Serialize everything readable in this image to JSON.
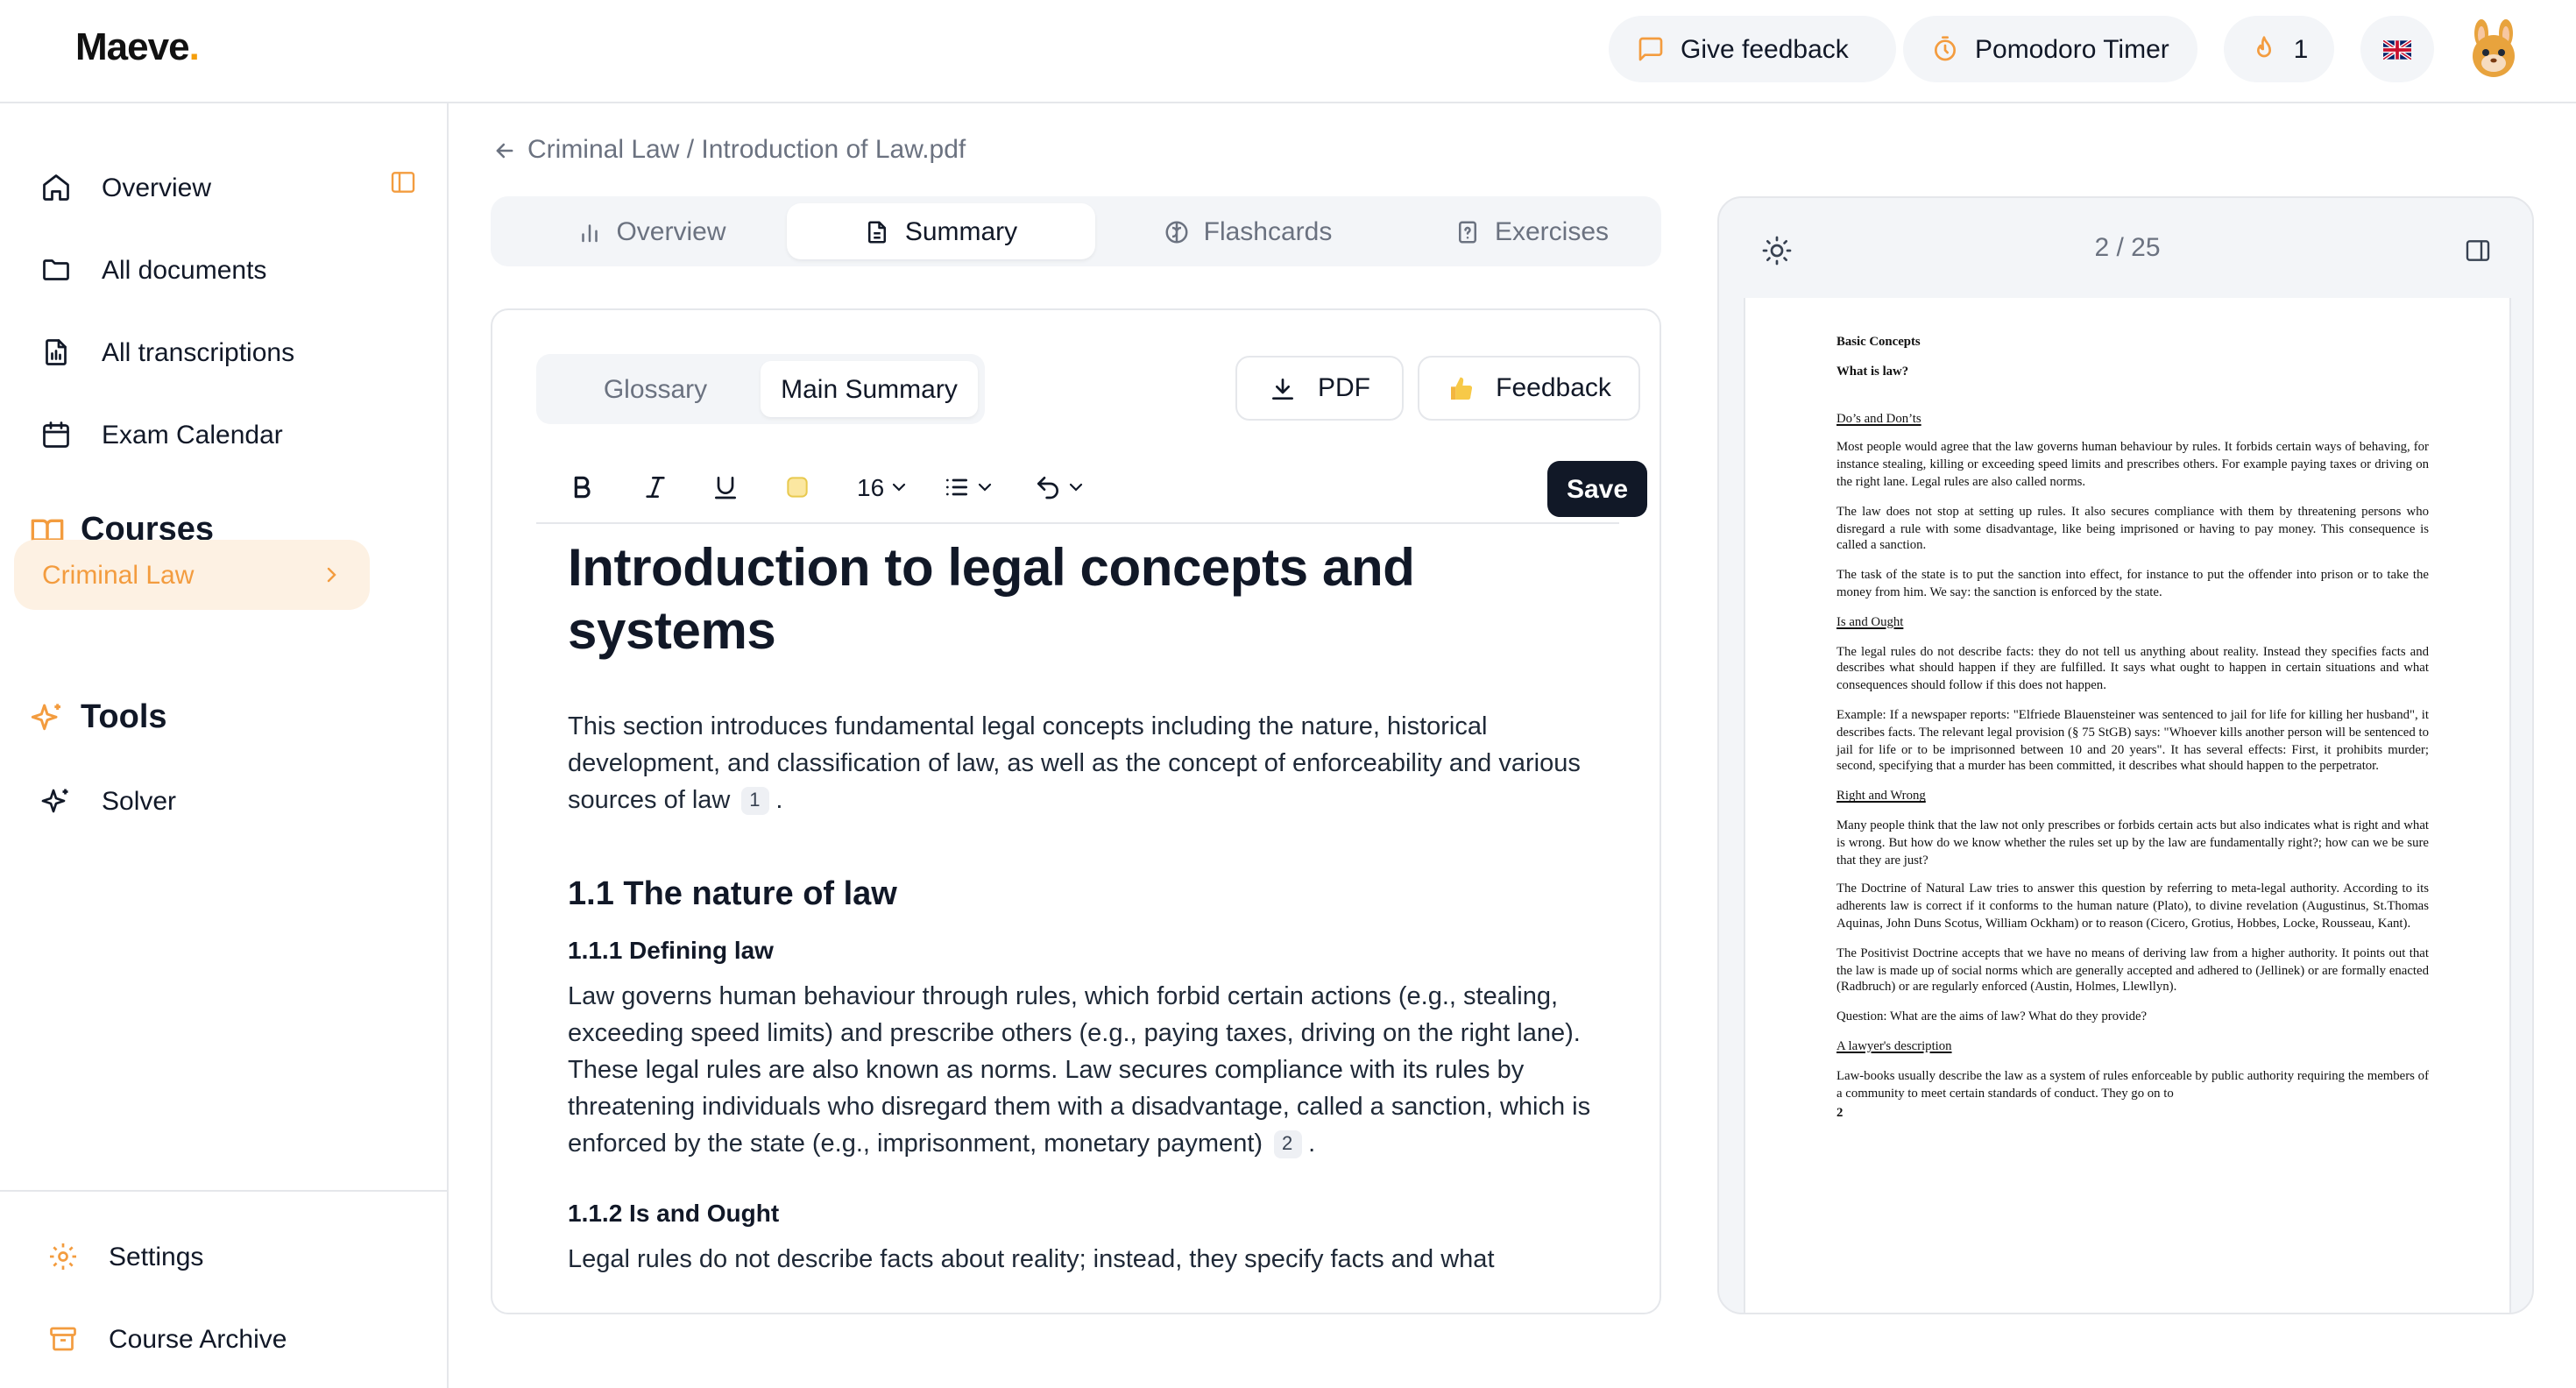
{
  "header": {
    "logo_text": "Maeve",
    "feedback_label": "Give feedback",
    "pomodoro_label": "Pomodoro Timer",
    "streak_count": "1",
    "language_flag": "uk-flag-icon",
    "avatar": "bunny-avatar-icon"
  },
  "sidebar": {
    "nav": [
      {
        "label": "Overview",
        "icon": "home-icon"
      },
      {
        "label": "All documents",
        "icon": "folder-icon"
      },
      {
        "label": "All transcriptions",
        "icon": "transcription-icon"
      },
      {
        "label": "Exam Calendar",
        "icon": "calendar-icon"
      }
    ],
    "courses_title": "Courses",
    "course_items": [
      {
        "label": "Criminal Law"
      }
    ],
    "tools_title": "Tools",
    "tool_items": [
      {
        "label": "Solver"
      }
    ],
    "bottom": [
      {
        "label": "Settings",
        "icon": "gear-icon"
      },
      {
        "label": "Course Archive",
        "icon": "archive-icon"
      }
    ]
  },
  "breadcrumb": "Criminal Law / Introduction of Law.pdf",
  "tabs": [
    {
      "label": "Overview"
    },
    {
      "label": "Summary",
      "active": true
    },
    {
      "label": "Flashcards"
    },
    {
      "label": "Exercises"
    }
  ],
  "editor": {
    "segments": [
      {
        "label": "Glossary"
      },
      {
        "label": "Main Summary",
        "active": true
      }
    ],
    "pdf_button": "PDF",
    "feedback_button": "Feedback",
    "font_size": "16",
    "save_label": "Save",
    "title": "Introduction to legal concepts and systems",
    "intro": "This section introduces fundamental legal concepts including the nature, historical development, and classification of law, as well as the concept of enforceability and various sources of law",
    "intro_ref": "1",
    "section_1": "1.1 The nature of law",
    "subsection_1": "1.1.1 Defining law",
    "para_1": "Law governs human behaviour through rules, which forbid certain actions (e.g., stealing, exceeding speed limits) and prescribe others (e.g., paying taxes, driving on the right lane). These legal rules are also known as norms. Law secures compliance with its rules by threatening individuals who disregard them with a disadvantage, called a sanction, which is enforced by the state (e.g., imprisonment, monetary payment)",
    "para_1_ref": "2",
    "subsection_2": "1.1.2 Is and Ought",
    "para_2": "Legal rules do not describe facts about reality; instead, they specify facts and what"
  },
  "pdf": {
    "page_indicator": "2 / 25",
    "heading": "Basic Concepts",
    "subheading": "What is law?",
    "s1": "Do’s and Don’ts",
    "p1": "Most people would agree that the law governs human behaviour by rules. It forbids certain ways of behaving, for instance stealing, killing or exceeding speed limits and prescribes others. For example paying taxes or driving on the right lane.  Legal rules are also called norms.",
    "p2": "The law does not stop at setting up rules. It also secures compliance with them by threatening persons who disregard a rule with some disadvantage, like being imprisoned or having to pay money. This consequence is called a sanction.",
    "p3": "The task of the state is to put the sanction into effect, for instance to put the offender into prison or to take the money from him. We say: the sanction is enforced by the state.",
    "s2": "Is and Ought",
    "p4": "The legal rules do not describe facts: they do not tell us anything about reality. Instead they specifies facts and describes what should happen if they are fulfilled. It says what ought to happen in certain situations and what consequences should follow if this does not happen.",
    "p5": "Example: If a newspaper reports: \"Elfriede Blauensteiner was sentenced to jail for life for killing her husband\", it describes facts. The relevant legal provision (§ 75 StGB) says: \"Whoever kills another person will be sentenced to jail for life or to be imprisonned between 10 and 20 years\".  It has several effects: First, it prohibits murder; second, specifying that a murder has been committed, it describes what should happen to the perpetrator.",
    "s3": "Right and Wrong",
    "p6": "Many people think that the law not only prescribes or forbids certain acts but also indicates what is right and what is wrong. But how do we know whether the rules set up by the law are fundamentally right?; how can we be sure that they are just?",
    "p7": "The Doctrine of Natural Law tries to answer this question by referring to meta-legal authority. According to its adherents law is correct if it conforms to the human nature (Plato), to divine revelation (Augustinus, St.Thomas Aquinas, John Duns Scotus, William Ockham) or to reason (Cicero, Grotius, Hobbes, Locke, Rousseau, Kant).",
    "p8": "The Positivist Doctrine accepts that we have no means of deriving law from a higher authority. It points out that the law is made up of social norms which are generally accepted and adhered to (Jellinek) or are formally enacted (Radbruch) or are regularly enforced (Austin, Holmes, Llewllyn).",
    "p9": "Question: What are the aims of law? What do they provide?",
    "s4": "A lawyer's description",
    "p10": "Law-books usually describe the law as  a system of rules enforceable by public authority requiring the members of a community to meet certain standards of conduct. They go on to",
    "page_number": "2"
  },
  "colors": {
    "accent": "#f39c3f",
    "dark": "#111827",
    "muted": "#6b7280"
  }
}
